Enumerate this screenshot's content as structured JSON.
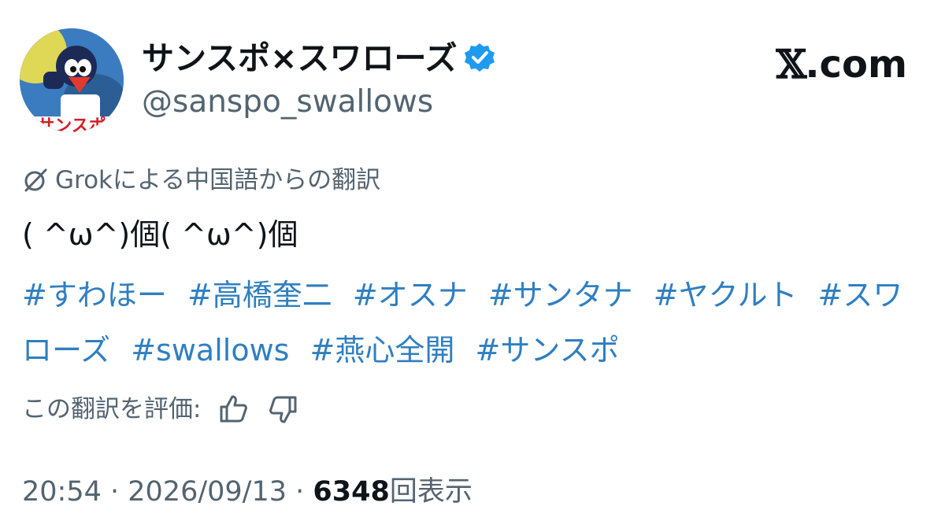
{
  "author": {
    "display_name": "サンスポ×スワローズ",
    "handle": "@sanspo_swallows",
    "verified": true,
    "avatar_icon": "swallows-mascot-avatar",
    "avatar_text": "サンスポ"
  },
  "brand": {
    "x_glyph": "𝕏",
    "suffix": ".com"
  },
  "translation": {
    "icon": "grok-icon",
    "label": "Grokによる中国語からの翻訳"
  },
  "tweet": {
    "text": "( ^ω^)個( ^ω^)個",
    "hashtags": [
      "#すわほー",
      "#高橋奎二",
      "#オスナ",
      "#サンタナ",
      "#ヤクルト",
      "#スワローズ",
      "#swallows",
      "#燕心全開",
      "#サンスポ"
    ]
  },
  "rating": {
    "label": "この翻訳を評価:",
    "thumbs_up_icon": "thumbs-up-icon",
    "thumbs_down_icon": "thumbs-down-icon"
  },
  "meta": {
    "time": "20:54",
    "separator": " · ",
    "date": "2026/09/13",
    "views_count": "6348",
    "views_label": "回表示"
  },
  "colors": {
    "link": "#2f7fc1",
    "secondary_text": "#536471",
    "verified_badge": "#1d9bf0"
  }
}
